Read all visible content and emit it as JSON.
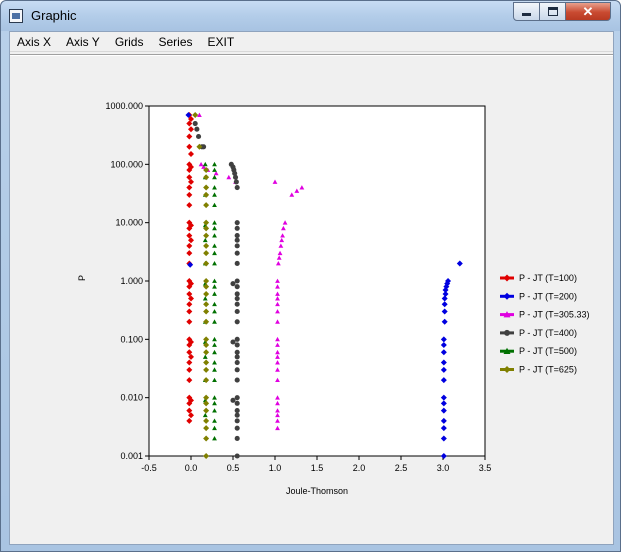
{
  "window": {
    "title": "Graphic",
    "icon": "app-window-icon",
    "controls": {
      "minimize": "minimize-icon",
      "maximize": "maximize-icon",
      "close": "close-icon"
    }
  },
  "menu": [
    {
      "label": "Axis X"
    },
    {
      "label": "Axis Y"
    },
    {
      "label": "Grids"
    },
    {
      "label": "Series"
    },
    {
      "label": "EXIT"
    }
  ],
  "chart_data": {
    "type": "scatter",
    "title": "",
    "xlabel": "Joule-Thomson",
    "ylabel": "P",
    "xlim": [
      -0.5,
      3.5
    ],
    "ylim": [
      0.001,
      1000
    ],
    "y_scale": "log",
    "x_ticks": [
      "-0.5",
      "0.0",
      "0.5",
      "1.0",
      "1.5",
      "2.0",
      "2.5",
      "3.0",
      "3.5"
    ],
    "y_ticks": [
      {
        "v": 0.001,
        "label": "0.001"
      },
      {
        "v": 0.01,
        "label": "0.010"
      },
      {
        "v": 0.1,
        "label": "0.100"
      },
      {
        "v": 1,
        "label": "1.000"
      },
      {
        "v": 10,
        "label": "10.000"
      },
      {
        "v": 100,
        "label": "100.000"
      },
      {
        "v": 1000,
        "label": "1000.000"
      }
    ],
    "grid": false,
    "legend_position": "right",
    "series": [
      {
        "name": "P - JT (T=100)",
        "color": "#e00000",
        "marker": "diamond",
        "points": [
          [
            -0.02,
            700
          ],
          [
            -0.02,
            500
          ],
          [
            -0.02,
            300
          ],
          [
            -0.02,
            200
          ],
          [
            -0.02,
            100
          ],
          [
            -0.02,
            80
          ],
          [
            -0.02,
            60
          ],
          [
            -0.02,
            40
          ],
          [
            -0.02,
            30
          ],
          [
            -0.02,
            20
          ],
          [
            -0.02,
            10
          ],
          [
            -0.02,
            8
          ],
          [
            -0.02,
            6
          ],
          [
            -0.02,
            4
          ],
          [
            -0.02,
            3
          ],
          [
            -0.02,
            2
          ],
          [
            -0.02,
            1
          ],
          [
            -0.02,
            0.8
          ],
          [
            -0.02,
            0.6
          ],
          [
            -0.02,
            0.4
          ],
          [
            -0.02,
            0.3
          ],
          [
            -0.02,
            0.2
          ],
          [
            -0.02,
            0.1
          ],
          [
            -0.02,
            0.08
          ],
          [
            -0.02,
            0.06
          ],
          [
            -0.02,
            0.04
          ],
          [
            -0.02,
            0.03
          ],
          [
            -0.02,
            0.02
          ],
          [
            -0.02,
            0.01
          ],
          [
            -0.02,
            0.008
          ],
          [
            -0.02,
            0.006
          ],
          [
            -0.02,
            0.004
          ],
          [
            0.0,
            600
          ],
          [
            0.0,
            400
          ],
          [
            0.0,
            150
          ],
          [
            0.0,
            90
          ],
          [
            0.0,
            50
          ],
          [
            0.0,
            9
          ],
          [
            0.0,
            5
          ],
          [
            0.0,
            0.9
          ],
          [
            0.0,
            0.5
          ],
          [
            0.0,
            0.09
          ],
          [
            0.0,
            0.05
          ],
          [
            0.0,
            0.009
          ],
          [
            0.0,
            0.005
          ]
        ]
      },
      {
        "name": "P - JT (T=200)",
        "color": "#0000e0",
        "marker": "diamond",
        "points": [
          [
            3.2,
            2
          ],
          [
            3.06,
            1
          ],
          [
            3.05,
            0.9
          ],
          [
            3.04,
            0.8
          ],
          [
            3.03,
            0.7
          ],
          [
            3.03,
            0.6
          ],
          [
            3.02,
            0.5
          ],
          [
            3.02,
            0.4
          ],
          [
            3.02,
            0.3
          ],
          [
            3.02,
            0.2
          ],
          [
            3.01,
            0.1
          ],
          [
            3.01,
            0.08
          ],
          [
            3.01,
            0.06
          ],
          [
            3.01,
            0.04
          ],
          [
            3.01,
            0.03
          ],
          [
            3.01,
            0.02
          ],
          [
            3.01,
            0.01
          ],
          [
            3.01,
            0.008
          ],
          [
            3.01,
            0.006
          ],
          [
            3.01,
            0.004
          ],
          [
            3.01,
            0.003
          ],
          [
            3.01,
            0.002
          ],
          [
            3.01,
            0.001
          ],
          [
            -0.03,
            700
          ],
          [
            -0.01,
            1.9
          ]
        ]
      },
      {
        "name": "P - JT (T=305.33)",
        "color": "#e000e0",
        "marker": "triangle",
        "points": [
          [
            1.32,
            40
          ],
          [
            1.26,
            35
          ],
          [
            1.2,
            30
          ],
          [
            1.0,
            50
          ],
          [
            1.12,
            10
          ],
          [
            1.1,
            8
          ],
          [
            1.09,
            6
          ],
          [
            1.08,
            5
          ],
          [
            1.07,
            4
          ],
          [
            1.06,
            3
          ],
          [
            1.05,
            2.5
          ],
          [
            1.04,
            2
          ],
          [
            1.03,
            1
          ],
          [
            1.03,
            0.8
          ],
          [
            1.03,
            0.6
          ],
          [
            1.03,
            0.5
          ],
          [
            1.03,
            0.4
          ],
          [
            1.03,
            0.3
          ],
          [
            1.03,
            0.2
          ],
          [
            1.03,
            0.1
          ],
          [
            1.03,
            0.08
          ],
          [
            1.03,
            0.06
          ],
          [
            1.03,
            0.05
          ],
          [
            1.03,
            0.04
          ],
          [
            1.03,
            0.03
          ],
          [
            1.03,
            0.02
          ],
          [
            1.03,
            0.01
          ],
          [
            1.03,
            0.008
          ],
          [
            1.03,
            0.006
          ],
          [
            1.03,
            0.005
          ],
          [
            1.03,
            0.004
          ],
          [
            1.03,
            0.003
          ],
          [
            0.12,
            100
          ],
          [
            0.15,
            90
          ],
          [
            0.2,
            80
          ],
          [
            0.3,
            70
          ],
          [
            0.45,
            60
          ],
          [
            0.53,
            50
          ],
          [
            0.1,
            700
          ]
        ]
      },
      {
        "name": "P - JT (T=400)",
        "color": "#404040",
        "marker": "circle",
        "points": [
          [
            0.05,
            500
          ],
          [
            0.07,
            400
          ],
          [
            0.09,
            300
          ],
          [
            0.13,
            200
          ],
          [
            0.15,
            200
          ],
          [
            0.48,
            100
          ],
          [
            0.5,
            90
          ],
          [
            0.51,
            80
          ],
          [
            0.52,
            70
          ],
          [
            0.53,
            60
          ],
          [
            0.54,
            50
          ],
          [
            0.55,
            40
          ],
          [
            0.55,
            10
          ],
          [
            0.55,
            8
          ],
          [
            0.55,
            6
          ],
          [
            0.55,
            5
          ],
          [
            0.55,
            4
          ],
          [
            0.55,
            3
          ],
          [
            0.55,
            2
          ],
          [
            0.55,
            1
          ],
          [
            0.55,
            0.8
          ],
          [
            0.55,
            0.6
          ],
          [
            0.55,
            0.5
          ],
          [
            0.55,
            0.4
          ],
          [
            0.55,
            0.3
          ],
          [
            0.55,
            0.2
          ],
          [
            0.55,
            0.1
          ],
          [
            0.55,
            0.08
          ],
          [
            0.55,
            0.06
          ],
          [
            0.55,
            0.05
          ],
          [
            0.55,
            0.04
          ],
          [
            0.55,
            0.03
          ],
          [
            0.55,
            0.02
          ],
          [
            0.55,
            0.01
          ],
          [
            0.55,
            0.008
          ],
          [
            0.55,
            0.006
          ],
          [
            0.55,
            0.005
          ],
          [
            0.55,
            0.004
          ],
          [
            0.55,
            0.003
          ],
          [
            0.55,
            0.002
          ],
          [
            0.55,
            0.001
          ],
          [
            0.5,
            0.9
          ],
          [
            0.5,
            0.09
          ],
          [
            0.5,
            0.009
          ]
        ]
      },
      {
        "name": "P - JT (T=500)",
        "color": "#007000",
        "marker": "triangle",
        "points": [
          [
            0.28,
            100
          ],
          [
            0.28,
            80
          ],
          [
            0.28,
            60
          ],
          [
            0.28,
            40
          ],
          [
            0.28,
            30
          ],
          [
            0.28,
            20
          ],
          [
            0.28,
            10
          ],
          [
            0.28,
            8
          ],
          [
            0.28,
            6
          ],
          [
            0.28,
            4
          ],
          [
            0.28,
            3
          ],
          [
            0.28,
            2
          ],
          [
            0.28,
            1
          ],
          [
            0.28,
            0.8
          ],
          [
            0.28,
            0.6
          ],
          [
            0.28,
            0.4
          ],
          [
            0.28,
            0.3
          ],
          [
            0.28,
            0.2
          ],
          [
            0.28,
            0.1
          ],
          [
            0.28,
            0.08
          ],
          [
            0.28,
            0.06
          ],
          [
            0.28,
            0.04
          ],
          [
            0.28,
            0.03
          ],
          [
            0.28,
            0.02
          ],
          [
            0.28,
            0.01
          ],
          [
            0.28,
            0.008
          ],
          [
            0.28,
            0.006
          ],
          [
            0.28,
            0.004
          ],
          [
            0.28,
            0.003
          ],
          [
            0.28,
            0.002
          ],
          [
            0.17,
            100
          ],
          [
            0.17,
            60
          ],
          [
            0.17,
            30
          ],
          [
            0.17,
            9
          ],
          [
            0.17,
            5
          ],
          [
            0.17,
            2
          ],
          [
            0.17,
            0.9
          ],
          [
            0.17,
            0.5
          ],
          [
            0.17,
            0.2
          ],
          [
            0.17,
            0.09
          ],
          [
            0.17,
            0.05
          ],
          [
            0.17,
            0.02
          ],
          [
            0.17,
            0.009
          ],
          [
            0.17,
            0.005
          ]
        ]
      },
      {
        "name": "P - JT (T=625)",
        "color": "#808000",
        "marker": "diamond",
        "points": [
          [
            0.05,
            700
          ],
          [
            0.1,
            200
          ],
          [
            0.18,
            80
          ],
          [
            0.18,
            60
          ],
          [
            0.18,
            40
          ],
          [
            0.18,
            30
          ],
          [
            0.18,
            20
          ],
          [
            0.18,
            10
          ],
          [
            0.18,
            8
          ],
          [
            0.18,
            6
          ],
          [
            0.18,
            4
          ],
          [
            0.18,
            3
          ],
          [
            0.18,
            2
          ],
          [
            0.18,
            1
          ],
          [
            0.18,
            0.8
          ],
          [
            0.18,
            0.6
          ],
          [
            0.18,
            0.4
          ],
          [
            0.18,
            0.3
          ],
          [
            0.18,
            0.2
          ],
          [
            0.18,
            0.1
          ],
          [
            0.18,
            0.08
          ],
          [
            0.18,
            0.06
          ],
          [
            0.18,
            0.04
          ],
          [
            0.18,
            0.03
          ],
          [
            0.18,
            0.02
          ],
          [
            0.18,
            0.01
          ],
          [
            0.18,
            0.008
          ],
          [
            0.18,
            0.006
          ],
          [
            0.18,
            0.004
          ],
          [
            0.18,
            0.003
          ],
          [
            0.18,
            0.002
          ],
          [
            0.18,
            0.001
          ]
        ]
      }
    ]
  }
}
